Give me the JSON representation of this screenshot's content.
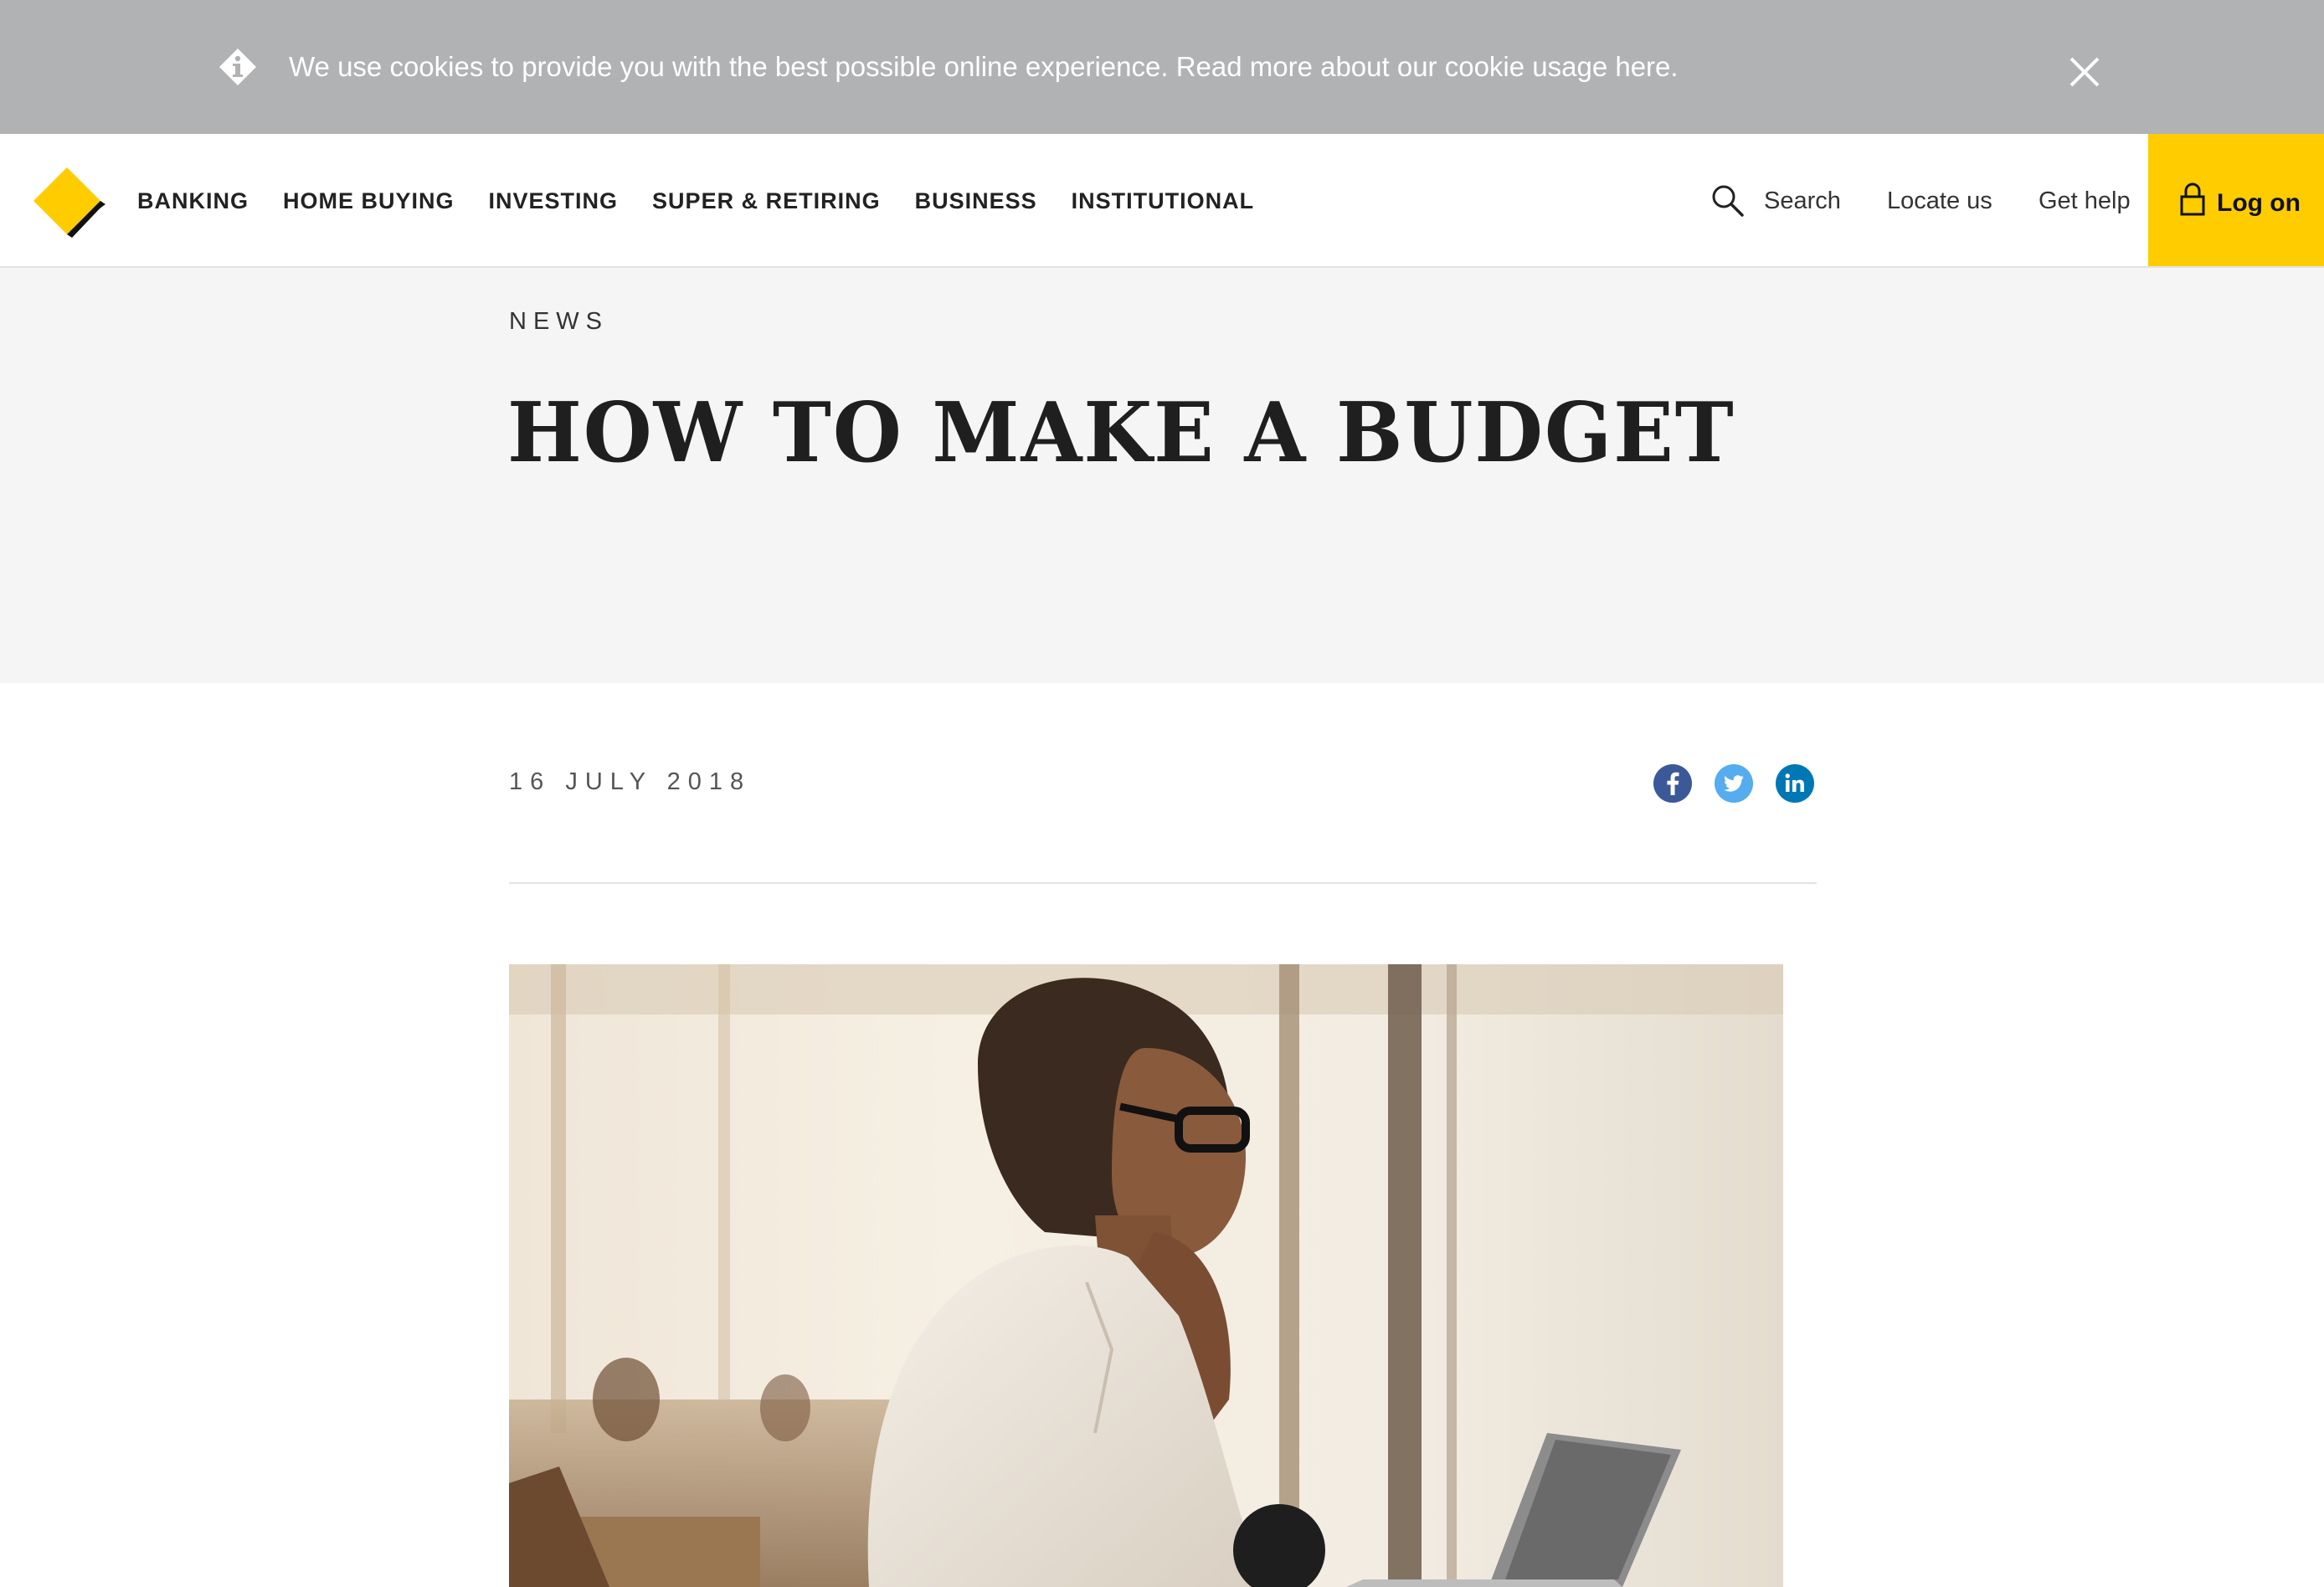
{
  "cookie_banner": {
    "message": "We use cookies to provide you with the best possible online experience. ",
    "link_text": "Read more about our cookie usage here",
    "suffix": ".",
    "info_icon": "info-diamond-icon",
    "close_icon": "close-icon"
  },
  "header": {
    "logo_icon": "commbank-diamond-logo",
    "nav": [
      "BANKING",
      "HOME BUYING",
      "INVESTING",
      "SUPER & RETIRING",
      "BUSINESS",
      "INSTITUTIONAL"
    ],
    "search_label": "Search",
    "locate_label": "Locate us",
    "help_label": "Get help",
    "logon_label": "Log on"
  },
  "article": {
    "eyebrow": "NEWS",
    "title": "HOW TO MAKE A BUDGET",
    "date": "16 JULY 2018",
    "share": [
      "facebook-icon",
      "twitter-icon",
      "linkedin-icon"
    ],
    "image_desc": "woman-at-laptop-photo"
  },
  "colors": {
    "brand_yellow": "#ffcc00",
    "cookie_bg": "#b1b2b4",
    "hero_bg": "#f5f5f5",
    "facebook": "#3b5998",
    "twitter": "#55acee",
    "linkedin": "#0077b5"
  }
}
